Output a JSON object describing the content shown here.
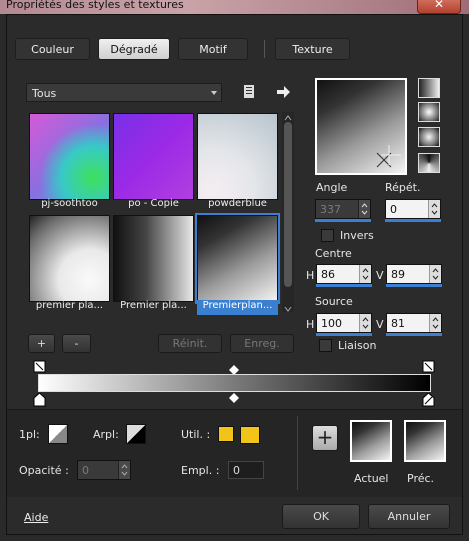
{
  "window": {
    "title": "Propriétés des styles et textures",
    "close_symbol": "✕"
  },
  "tabs": [
    {
      "label": "Couleur",
      "active": false
    },
    {
      "label": "Dégradé",
      "active": true
    },
    {
      "label": "Motif",
      "active": false
    },
    {
      "label": "Texture",
      "active": false
    }
  ],
  "filter": {
    "value": "Tous"
  },
  "gallery": [
    {
      "label": "pj-soothtoo",
      "selected": false
    },
    {
      "label": "po - Copie",
      "selected": false
    },
    {
      "label": "powderblue",
      "selected": false
    },
    {
      "label": "premier pla...",
      "selected": false
    },
    {
      "label": "Premier pla...",
      "selected": false
    },
    {
      "label": "Premierplan...",
      "selected": true
    }
  ],
  "gallery_buttons": {
    "add": "+",
    "remove": "-",
    "reset": "Réinit.",
    "save": "Enreg."
  },
  "angle": {
    "label": "Angle",
    "value": "337"
  },
  "repeat": {
    "label": "Répét.",
    "value": "0"
  },
  "invert": {
    "label": "Invers",
    "checked": false
  },
  "center": {
    "label": "Centre",
    "h_label": "H",
    "h": "86",
    "v_label": "V",
    "v": "89"
  },
  "source": {
    "label": "Source",
    "h_label": "H",
    "h": "100",
    "v_label": "V",
    "v": "81"
  },
  "link": {
    "label": "Liaison",
    "checked": false
  },
  "bottom": {
    "stop_label": "1pl:",
    "arpl_label": "Arpl:",
    "util_label": "Util. :",
    "opacity_label": "Opacité :",
    "opacity_value": "0",
    "emplacement_label": "Empl. :",
    "emplacement_value": "0",
    "accent_color": "#f2c318",
    "actual_label": "Actuel",
    "previous_label": "Préc."
  },
  "footer": {
    "help": "Aide",
    "ok": "OK",
    "cancel": "Annuler"
  },
  "colors": {
    "selection": "#3b7fd1",
    "panel": "#2b2b2b"
  }
}
